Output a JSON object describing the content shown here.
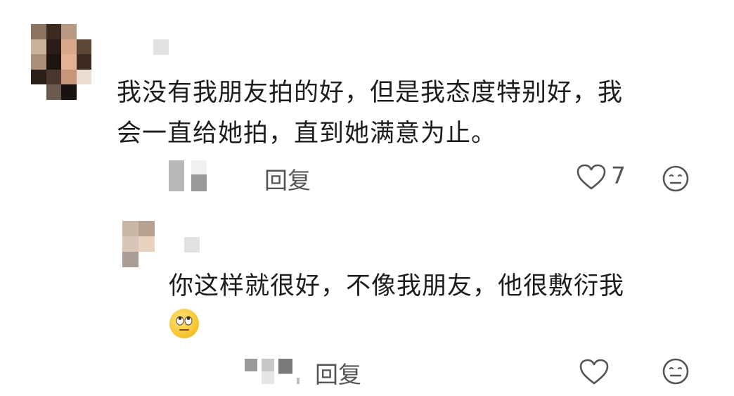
{
  "comment": {
    "text_line1": "我没有我朋友拍的好，但是我态度特别好，我",
    "text_line2": "会一直给她拍，直到她满意为止。",
    "reply_label": "回复",
    "like_count": "7",
    "like_icon": "heart-outline-icon",
    "dislike_icon": "neutral-face-icon"
  },
  "reply": {
    "text_line1": "你这样就很好，不像我朋友，他很敷衍我",
    "emoji": "face-with-rolling-eyes-emoji",
    "reply_label": "回复",
    "like_icon": "heart-outline-icon",
    "dislike_icon": "neutral-face-icon"
  }
}
